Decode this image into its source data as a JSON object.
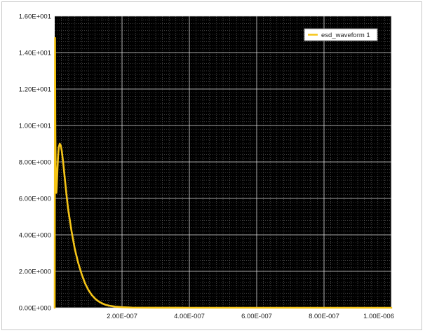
{
  "chart_data": {
    "type": "line",
    "title": "",
    "xlabel": "",
    "ylabel": "",
    "xlim": [
      0,
      1e-06
    ],
    "ylim": [
      0,
      16
    ],
    "x_ticks": [
      {
        "value": 2e-07,
        "label": "2.00E-007"
      },
      {
        "value": 4e-07,
        "label": "4.00E-007"
      },
      {
        "value": 6e-07,
        "label": "6.00E-007"
      },
      {
        "value": 8e-07,
        "label": "8.00E-007"
      },
      {
        "value": 1e-06,
        "label": "1.00E-006"
      }
    ],
    "y_ticks": [
      {
        "value": 0,
        "label": "0.00E+000"
      },
      {
        "value": 2,
        "label": "2.00E+000"
      },
      {
        "value": 4,
        "label": "4.00E+000"
      },
      {
        "value": 6,
        "label": "6.00E+000"
      },
      {
        "value": 8,
        "label": "8.00E+000"
      },
      {
        "value": 10,
        "label": "1.00E+001"
      },
      {
        "value": 12,
        "label": "1.20E+001"
      },
      {
        "value": 14,
        "label": "1.40E+001"
      },
      {
        "value": 16,
        "label": "1.60E+001"
      }
    ],
    "grid": true,
    "minor_grid": true,
    "background": "#000000",
    "legend_position": "top-right",
    "series": [
      {
        "name": "esd_waveform 1",
        "color": "#f5c518",
        "x": [
          0,
          5e-10,
          1e-09,
          1.5e-09,
          2e-09,
          3e-09,
          4e-09,
          5e-09,
          6e-09,
          8e-09,
          1e-08,
          1.2e-08,
          1.5e-08,
          1.8e-08,
          2.1e-08,
          2.5e-08,
          3e-08,
          3.5e-08,
          4e-08,
          5e-08,
          6e-08,
          7e-08,
          8e-08,
          9e-08,
          1e-07,
          1.1e-07,
          1.2e-07,
          1.3e-07,
          1.4e-07,
          1.5e-07,
          1.6e-07,
          1.8e-07,
          2e-07,
          2.3e-07,
          2.6e-07,
          3e-07,
          4e-07,
          5e-07,
          6e-07,
          7e-07,
          8e-07,
          9e-07,
          1e-06
        ],
        "y": [
          0,
          8.0,
          14.8,
          12.0,
          9.5,
          7.5,
          6.5,
          6.3,
          6.6,
          7.5,
          8.3,
          8.8,
          9.0,
          8.9,
          8.6,
          8.0,
          7.1,
          6.2,
          5.4,
          4.2,
          3.2,
          2.45,
          1.85,
          1.35,
          0.98,
          0.7,
          0.5,
          0.35,
          0.25,
          0.17,
          0.12,
          0.06,
          0.03,
          0.01,
          0.005,
          0.002,
          0.0,
          0.0,
          0.0,
          0.0,
          0.0,
          0.0,
          0.0
        ]
      }
    ]
  }
}
